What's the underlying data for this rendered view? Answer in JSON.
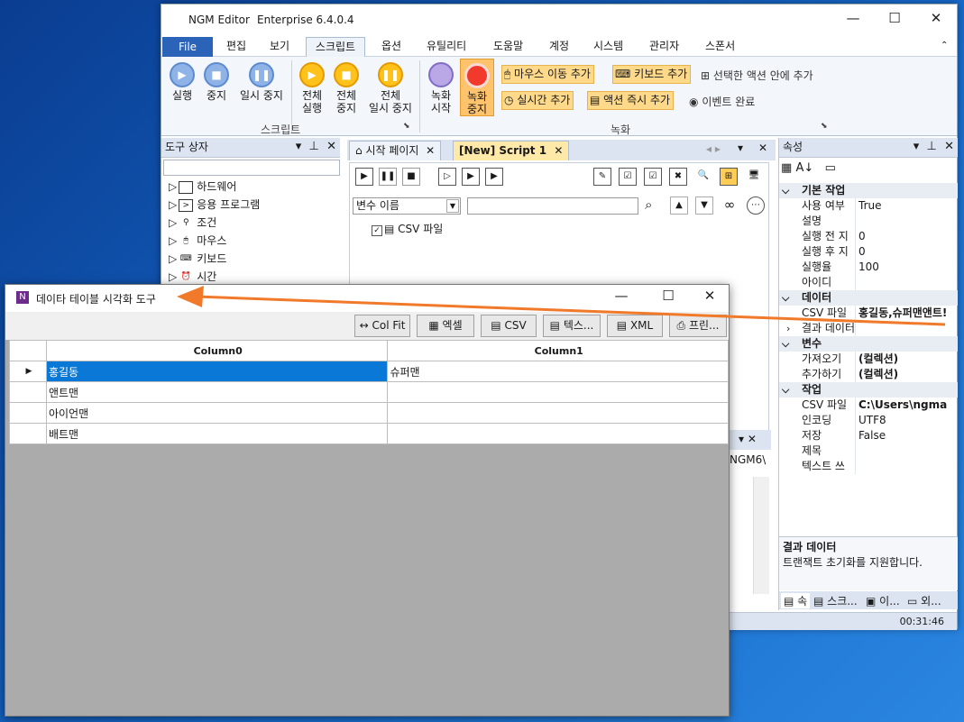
{
  "main_window": {
    "app": "NGM Editor",
    "edition": "Enterprise 6.4.0.4"
  },
  "menu": [
    "File",
    "편집",
    "보기",
    "스크립트",
    "옵션",
    "유틸리티",
    "도움말",
    "계정",
    "시스템",
    "관리자",
    "스폰서"
  ],
  "ribbon": {
    "run": "실행",
    "stop": "중지",
    "pause": "일시 중지",
    "run_all_1": "전체",
    "run_all_2": "실행",
    "stop_all_1": "전체",
    "stop_all_2": "중지",
    "pause_all_1": "전체",
    "pause_all_2": "일시 중지",
    "script_group": "스크립트",
    "rec_start_1": "녹화",
    "rec_start_2": "시작",
    "rec_stop_1": "녹화",
    "rec_stop_2": "중지",
    "add_mouse": "마우스 이동 추가",
    "add_keyboard": "키보드 추가",
    "add_in_selected": "선택한 액션 안에 추가",
    "add_realtime": "실시간 추가",
    "add_action_now": "액션 즉시 추가",
    "event_done": "이벤트 완료",
    "record_group": "녹화"
  },
  "toolbox": {
    "title": "도구 상자",
    "items": [
      "하드웨어",
      "응용 프로그램",
      "조건",
      "마우스",
      "키보드",
      "시간"
    ]
  },
  "editor": {
    "tab_start": "시작 페이지",
    "tab_script": "[New] Script 1",
    "var_placeholder": "변수 이름",
    "csv_item": "CSV 파일",
    "path_frag": "NGM6\\"
  },
  "properties": {
    "title": "속성",
    "sec_basic": "기본 작업",
    "use": "사용 여부",
    "use_v": "True",
    "desc": "설명",
    "pre_delay": "실행 전 지",
    "pre_delay_v": "0",
    "post_delay": "실행 후 지",
    "post_delay_v": "0",
    "rate": "실행율",
    "rate_v": "100",
    "id": "아이디",
    "sec_data": "데이터",
    "csv": "CSV 파일",
    "csv_v": "홍길동,슈퍼맨앤트!",
    "result": "결과 데이터",
    "sec_var": "변수",
    "get": "가져오기",
    "get_v": "(컬렉션)",
    "add": "추가하기",
    "add_v": "(컬렉션)",
    "sec_task": "작업",
    "csvfile": "CSV 파일",
    "csvfile_v": "C:\\Users\\ngma",
    "enc": "인코딩",
    "enc_v": "UTF8",
    "save": "저장",
    "save_v": "False",
    "title_k": "제목",
    "text_write": "텍스트 쓰",
    "desc_title": "결과 데이터",
    "desc_text": "트랜잭트 초기화를 지원합니다.",
    "tabs": [
      "속",
      "스크...",
      "이...",
      "외..."
    ]
  },
  "status": {
    "time": "00:31:46"
  },
  "dt_window": {
    "title": "데이타 테이블 시각화 도구",
    "toolbar": [
      "Col Fit",
      "엑셀",
      "CSV",
      "텍스...",
      "XML",
      "프린..."
    ],
    "columns": [
      "Column0",
      "Column1"
    ],
    "rows": [
      [
        "홍길동",
        "슈퍼맨"
      ],
      [
        "앤트맨",
        ""
      ],
      [
        "아이언맨",
        ""
      ],
      [
        "배트맨",
        ""
      ]
    ]
  },
  "colors": {
    "accent": "#2b63b8",
    "arrow": "#f07a2a"
  }
}
